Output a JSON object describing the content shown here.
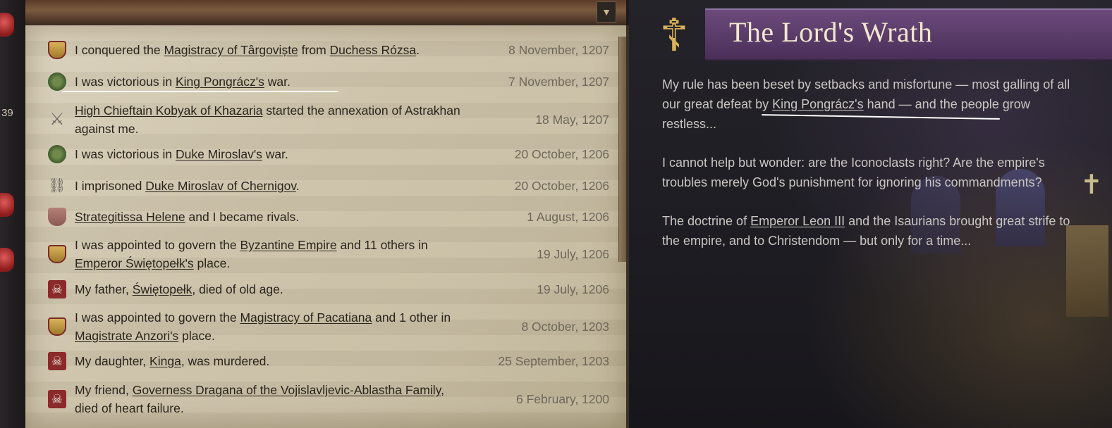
{
  "sidebar": {
    "number": "39"
  },
  "log": {
    "entries": [
      {
        "icon": "shield-icon",
        "text_parts": [
          "I conquered the ",
          "Magistracy of Târgoviște",
          " from ",
          "Duchess Rózsa",
          "."
        ],
        "date": "8 November, 1207"
      },
      {
        "icon": "crossed-swords-victory-icon",
        "text_parts": [
          "I was victorious in ",
          "King Pongrácz's",
          " war."
        ],
        "date": "7 November, 1207"
      },
      {
        "icon": "swords-icon",
        "text_parts": [
          "High Chieftain Kobyak of Khazaria",
          " started the annexation of ",
          "Astrakhan",
          " against me."
        ],
        "date": "18 May, 1207"
      },
      {
        "icon": "crossed-swords-victory-icon",
        "text_parts": [
          "I was victorious in ",
          "Duke Miroslav's",
          " war."
        ],
        "date": "20 October, 1206"
      },
      {
        "icon": "chains-icon",
        "text_parts": [
          "I imprisoned ",
          "Duke Miroslav of Chernigov",
          "."
        ],
        "date": "20 October, 1206"
      },
      {
        "icon": "rival-icon",
        "text_parts": [
          "Strategitissa Helene",
          " and I became rivals."
        ],
        "date": "1 August, 1206"
      },
      {
        "icon": "shield-icon",
        "text_parts": [
          "I was appointed to govern the ",
          "Byzantine Empire",
          " and 11 others in ",
          "Emperor Świętopełk's",
          " place."
        ],
        "date": "19 July, 1206"
      },
      {
        "icon": "skull-icon",
        "text_parts": [
          "My father, ",
          "Świętopełk",
          ", died of old age."
        ],
        "date": "19 July, 1206"
      },
      {
        "icon": "shield-icon",
        "text_parts": [
          "I was appointed to govern the ",
          "Magistracy of Pacatiana",
          " and 1 other in ",
          "Magistrate Anzori's",
          " place."
        ],
        "date": "8 October, 1203"
      },
      {
        "icon": "skull-icon",
        "text_parts": [
          "My daughter, ",
          "Kinga",
          ", was murdered."
        ],
        "date": "25 September, 1203"
      },
      {
        "icon": "skull-icon",
        "text_parts": [
          "My friend, ",
          "Governess Dragana of the Vojislavljevic-Ablastha Family",
          ", died of heart failure."
        ],
        "date": "6 February, 1200"
      }
    ]
  },
  "event": {
    "title": "The Lord's Wrath",
    "paragraphs": [
      [
        "My rule has been beset by setbacks and misfortune — most galling of all our great defeat by ",
        "King Pongrácz's",
        " hand — and the people grow restless..."
      ],
      [
        "I cannot help but wonder: are the Iconoclasts right? Are the empire's troubles merely God's punishment for ignoring his commandments?"
      ],
      [
        "The doctrine of ",
        "Emperor Leon III",
        " and the Isaurians brought great strife to the empire, and to Christendom — but only for a time..."
      ]
    ]
  },
  "colors": {
    "parchment": "#cdc3aa",
    "event_bg": "#1d1c22",
    "title": "#f2e7d0",
    "header_band": "#5a3b6a"
  }
}
